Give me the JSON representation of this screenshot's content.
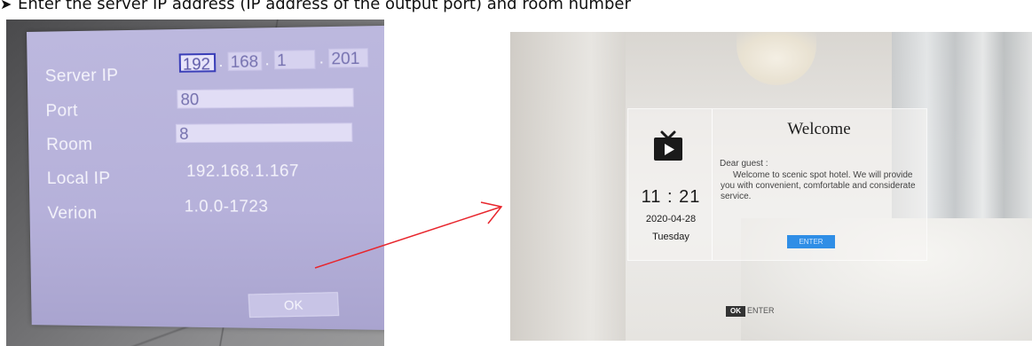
{
  "instruction": {
    "bullet": "➤",
    "text": "Enter the server IP address (IP address of the output port) and room number"
  },
  "settings_dialog": {
    "labels": {
      "server_ip": "Server IP",
      "port": "Port",
      "room": "Room",
      "local_ip": "Local IP",
      "version": "Verion"
    },
    "server_ip_octets": [
      "192",
      "168",
      "1",
      "201"
    ],
    "ip_separator": ".",
    "port_value": "80",
    "room_value": "8",
    "local_ip_value": "192.168.1.167",
    "version_value": "1.0.0-1723",
    "ok_label": "OK"
  },
  "welcome_screen": {
    "tv_icon": "tv-icon",
    "time": "11 : 21",
    "date": "2020-04-28",
    "weekday": "Tuesday",
    "title": "Welcome",
    "greeting": "Dear guest :",
    "message": "Welcome to scenic spot hotel. We will provide you with convenient, comfortable and considerate service.",
    "enter_button": "ENTER",
    "hint_key": "OK",
    "hint_text": "ENTER"
  },
  "colors": {
    "arrow": "#e8262d",
    "dialog_bg": "#b8b4dc",
    "enter_button": "#2f8ee6"
  }
}
